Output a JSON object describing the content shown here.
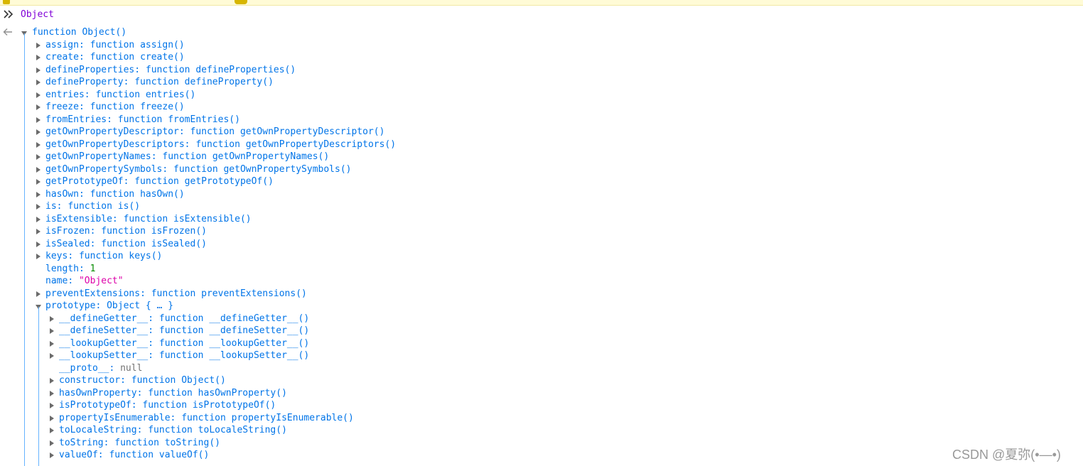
{
  "console": {
    "input_text": "Object",
    "root_label": "function Object()",
    "static_members": [
      {
        "key": "assign",
        "value": "function assign()",
        "type": "fn"
      },
      {
        "key": "create",
        "value": "function create()",
        "type": "fn"
      },
      {
        "key": "defineProperties",
        "value": "function defineProperties()",
        "type": "fn"
      },
      {
        "key": "defineProperty",
        "value": "function defineProperty()",
        "type": "fn"
      },
      {
        "key": "entries",
        "value": "function entries()",
        "type": "fn"
      },
      {
        "key": "freeze",
        "value": "function freeze()",
        "type": "fn"
      },
      {
        "key": "fromEntries",
        "value": "function fromEntries()",
        "type": "fn"
      },
      {
        "key": "getOwnPropertyDescriptor",
        "value": "function getOwnPropertyDescriptor()",
        "type": "fn"
      },
      {
        "key": "getOwnPropertyDescriptors",
        "value": "function getOwnPropertyDescriptors()",
        "type": "fn"
      },
      {
        "key": "getOwnPropertyNames",
        "value": "function getOwnPropertyNames()",
        "type": "fn"
      },
      {
        "key": "getOwnPropertySymbols",
        "value": "function getOwnPropertySymbols()",
        "type": "fn"
      },
      {
        "key": "getPrototypeOf",
        "value": "function getPrototypeOf()",
        "type": "fn"
      },
      {
        "key": "hasOwn",
        "value": "function hasOwn()",
        "type": "fn"
      },
      {
        "key": "is",
        "value": "function is()",
        "type": "fn"
      },
      {
        "key": "isExtensible",
        "value": "function isExtensible()",
        "type": "fn"
      },
      {
        "key": "isFrozen",
        "value": "function isFrozen()",
        "type": "fn"
      },
      {
        "key": "isSealed",
        "value": "function isSealed()",
        "type": "fn"
      },
      {
        "key": "keys",
        "value": "function keys()",
        "type": "fn"
      },
      {
        "key": "length",
        "value": "1",
        "type": "num"
      },
      {
        "key": "name",
        "value": "\"Object\"",
        "type": "str"
      },
      {
        "key": "preventExtensions",
        "value": "function preventExtensions()",
        "type": "fn"
      },
      {
        "key": "prototype",
        "value": "Object { … }",
        "type": "obj-open"
      }
    ],
    "prototype_members": [
      {
        "key": "__defineGetter__",
        "value": "function __defineGetter__()",
        "type": "fn"
      },
      {
        "key": "__defineSetter__",
        "value": "function __defineSetter__()",
        "type": "fn"
      },
      {
        "key": "__lookupGetter__",
        "value": "function __lookupGetter__()",
        "type": "fn"
      },
      {
        "key": "__lookupSetter__",
        "value": "function __lookupSetter__()",
        "type": "fn"
      },
      {
        "key": "__proto__",
        "value": "null",
        "type": "null"
      },
      {
        "key": "constructor",
        "value": "function Object()",
        "type": "fn"
      },
      {
        "key": "hasOwnProperty",
        "value": "function hasOwnProperty()",
        "type": "fn"
      },
      {
        "key": "isPrototypeOf",
        "value": "function isPrototypeOf()",
        "type": "fn"
      },
      {
        "key": "propertyIsEnumerable",
        "value": "function propertyIsEnumerable()",
        "type": "fn"
      },
      {
        "key": "toLocaleString",
        "value": "function toLocaleString()",
        "type": "fn"
      },
      {
        "key": "toString",
        "value": "function toString()",
        "type": "fn"
      },
      {
        "key": "valueOf",
        "value": "function valueOf()",
        "type": "fn"
      }
    ]
  },
  "watermark": "CSDN @夏弥(•—•)",
  "colors": {
    "key": "#0074e8",
    "number": "#058b00",
    "string": "#dd00a9",
    "null": "#737373",
    "input": "#8000d7",
    "guide": "#66b3ff"
  },
  "icons": {
    "prompt": "chevron-double-right-icon",
    "result": "arrow-left-icon",
    "twisty_closed": "triangle-right-icon",
    "twisty_open": "triangle-down-icon"
  }
}
